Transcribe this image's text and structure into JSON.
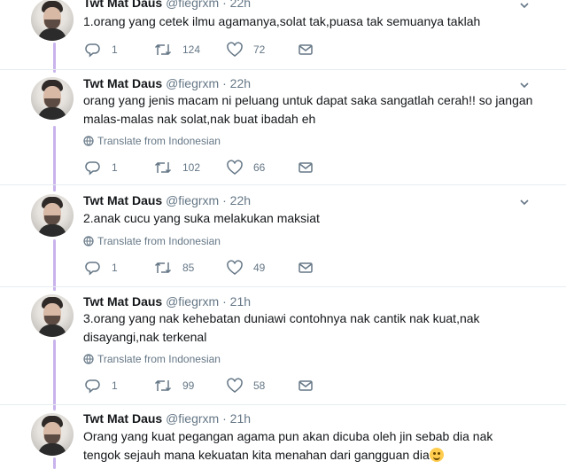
{
  "translate_label": "Translate from Indonesian",
  "tweets": [
    {
      "name": "Twt Mat Daus",
      "handle": "@fiegrxm",
      "dot": "·",
      "time": "22h",
      "text": "1.orang yang cetek ilmu agamanya,solat tak,puasa tak semuanya taklah",
      "replies": "1",
      "retweets": "124",
      "likes": "72"
    },
    {
      "name": "Twt Mat Daus",
      "handle": "@fiegrxm",
      "dot": "·",
      "time": "22h",
      "text": "orang yang jenis macam ni peluang untuk dapat saka sangatlah cerah!! so jangan malas-malas nak solat,nak buat ibadah eh",
      "replies": "1",
      "retweets": "102",
      "likes": "66"
    },
    {
      "name": "Twt Mat Daus",
      "handle": "@fiegrxm",
      "dot": "·",
      "time": "22h",
      "text": "2.anak cucu yang suka melakukan maksiat",
      "replies": "1",
      "retweets": "85",
      "likes": "49"
    },
    {
      "name": "Twt Mat Daus",
      "handle": "@fiegrxm",
      "dot": "·",
      "time": "21h",
      "text_line1": "3.orang yang nak kehebatan duniawi contohnya nak cantik nak kuat,nak",
      "text_line2": "disayangi,nak terkenal",
      "replies": "1",
      "retweets": "99",
      "likes": "58"
    },
    {
      "name": "Twt Mat Daus",
      "handle": "@fiegrxm",
      "dot": "·",
      "time": "21h",
      "text_line1": "Orang yang kuat pegangan agama pun akan dicuba oleh jin sebab dia nak",
      "text_line2": "tengok sejauh mana kekuatan kita menahan dari gangguan dia",
      "emoji": "smiling-face-emoji"
    }
  ]
}
